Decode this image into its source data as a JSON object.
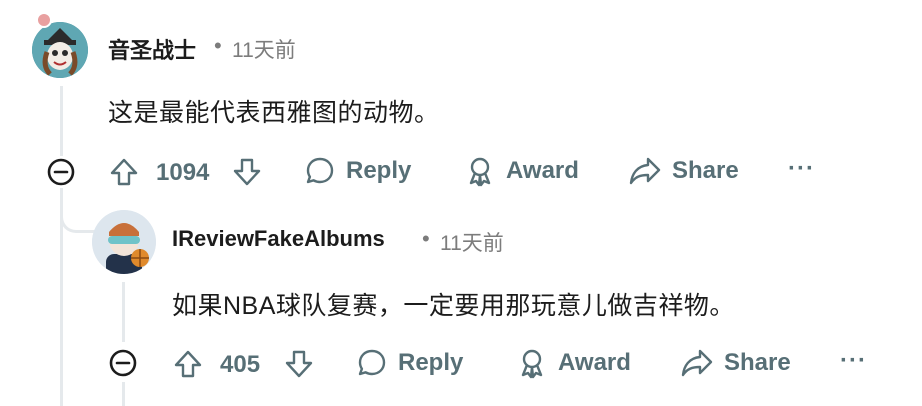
{
  "comments": [
    {
      "username": "音圣战士",
      "separator": "•",
      "time": "11天前",
      "body": "这是最能代表西雅图的动物。",
      "votes": "1094",
      "actions": {
        "reply": "Reply",
        "award": "Award",
        "share": "Share",
        "more": "···"
      }
    },
    {
      "username": "IReviewFakeAlbums",
      "separator": "•",
      "time": "11天前",
      "body": "如果NBA球队复赛，一定要用那玩意儿做吉祥物。",
      "votes": "405",
      "actions": {
        "reply": "Reply",
        "award": "Award",
        "share": "Share",
        "more": "···"
      }
    }
  ],
  "colors": {
    "text_primary": "#1c1c1c",
    "text_muted": "#7c7c7c",
    "action_gray": "#576f76",
    "thread_line": "#e5e9ec"
  }
}
